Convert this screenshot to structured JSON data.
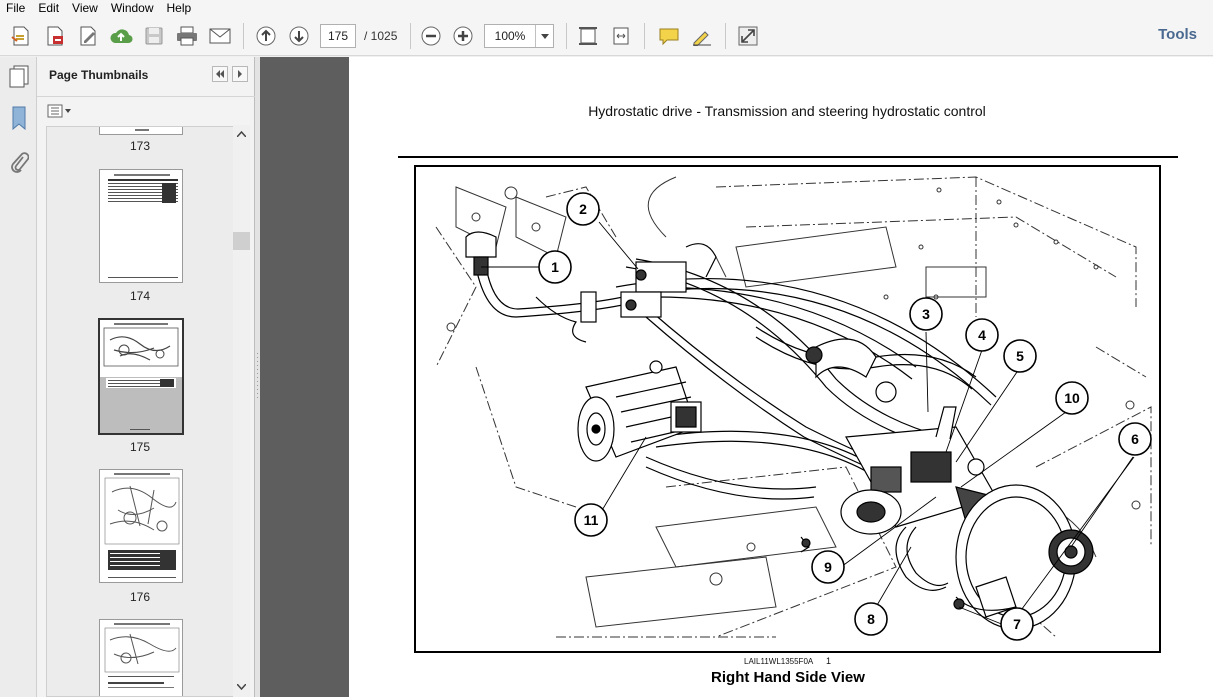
{
  "menu": [
    "File",
    "Edit",
    "View",
    "Window",
    "Help"
  ],
  "toolbar": {
    "current_page": "175",
    "total_pages": "/ 1025",
    "zoom": "100%",
    "tools_label": "Tools",
    "icons": [
      "create-icon",
      "export-pdf-icon",
      "edit-icon",
      "upload-icon",
      "save-icon",
      "print-icon",
      "email-icon",
      "page-up-icon",
      "page-down-icon",
      "zoom-out-icon",
      "zoom-in-icon",
      "fit-page-icon",
      "fit-width-icon",
      "comment-icon",
      "sign-icon",
      "expand-icon"
    ]
  },
  "panel": {
    "title": "Page Thumbnails",
    "thumbnails": [
      {
        "label": "173",
        "selected": false
      },
      {
        "label": "174",
        "selected": false
      },
      {
        "label": "175",
        "selected": true
      },
      {
        "label": "176",
        "selected": false
      }
    ]
  },
  "document": {
    "header": "Hydrostatic drive - Transmission and steering hydrostatic control",
    "figure_code": "LAIL11WL1355F0A",
    "figure_number": "1",
    "caption": "Right Hand Side View",
    "callouts": [
      "1",
      "2",
      "3",
      "4",
      "5",
      "6",
      "7",
      "8",
      "9",
      "10",
      "11"
    ]
  }
}
